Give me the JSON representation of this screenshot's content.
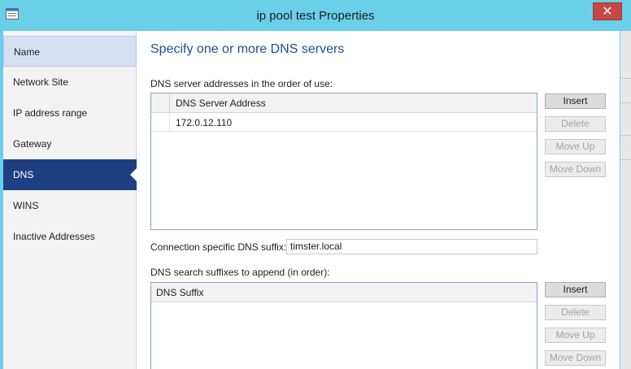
{
  "window": {
    "title": "ip pool test Properties",
    "close_glyph": "✕",
    "icon": "properties-window-icon"
  },
  "sidebar": {
    "items": [
      {
        "label": "Name"
      },
      {
        "label": "Network Site"
      },
      {
        "label": "IP address range"
      },
      {
        "label": "Gateway"
      },
      {
        "label": "DNS"
      },
      {
        "label": "WINS"
      },
      {
        "label": "Inactive Addresses"
      }
    ],
    "selected": "DNS"
  },
  "main": {
    "heading": "Specify one or more DNS servers",
    "dns_servers": {
      "label": "DNS server addresses in the order of use:",
      "column_header": "DNS Server Address",
      "rows": [
        "172.0.12.110"
      ],
      "buttons": {
        "insert": "Insert",
        "delete": "Delete",
        "move_up": "Move Up",
        "move_down": "Move Down"
      }
    },
    "connection_suffix": {
      "label": "Connection specific DNS suffix:",
      "value": "timster.local"
    },
    "search_suffixes": {
      "label": "DNS search suffixes to append (in order):",
      "column_header": "DNS Suffix",
      "buttons": {
        "insert": "Insert",
        "delete": "Delete",
        "move_up": "Move Up",
        "move_down": "Move Down"
      }
    }
  },
  "colors": {
    "titlebar": "#6acfe8",
    "selected_nav": "#1f3f83",
    "heading": "#1f4e96",
    "close_button": "#c74744"
  }
}
